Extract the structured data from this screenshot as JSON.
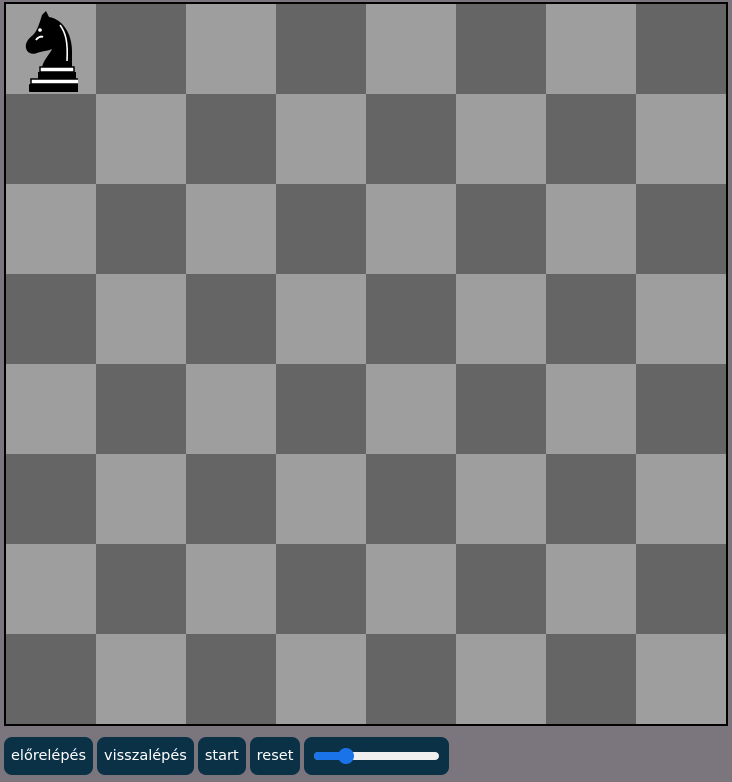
{
  "board": {
    "size": 8,
    "light_color": "#9e9e9e",
    "dark_color": "#656565",
    "pieces": [
      {
        "type": "knight",
        "color": "black",
        "square": "a8",
        "icon": "black-knight-icon"
      }
    ]
  },
  "controls": {
    "forward_label": "előrelépés",
    "back_label": "visszalépés",
    "start_label": "start",
    "reset_label": "reset",
    "speed_slider": {
      "value": 0.25,
      "accent": "#1a73e8"
    }
  }
}
